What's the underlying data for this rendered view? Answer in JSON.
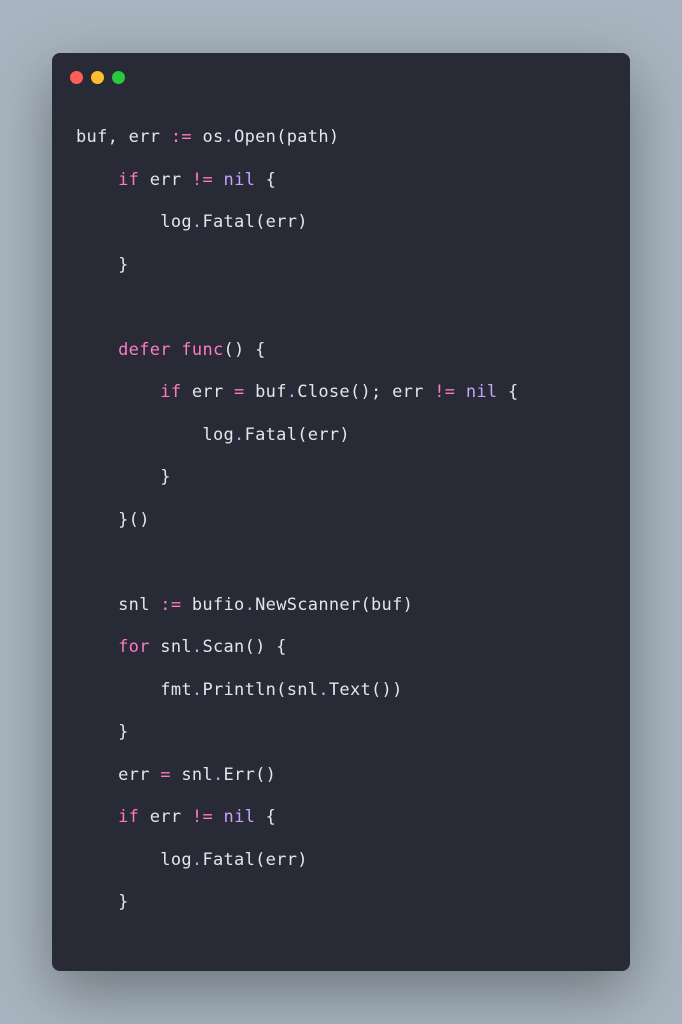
{
  "code": {
    "tokens": [
      [
        {
          "t": "buf, err ",
          "c": "id"
        },
        {
          "t": ":=",
          "c": "op"
        },
        {
          "t": " os",
          "c": "id"
        },
        {
          "t": ".",
          "c": "dot"
        },
        {
          "t": "Open(path)",
          "c": "fn"
        }
      ],
      [
        {
          "t": "    ",
          "c": "id"
        },
        {
          "t": "if",
          "c": "kw"
        },
        {
          "t": " err ",
          "c": "id"
        },
        {
          "t": "!=",
          "c": "op"
        },
        {
          "t": " ",
          "c": "id"
        },
        {
          "t": "nil",
          "c": "nil"
        },
        {
          "t": " {",
          "c": "brace"
        }
      ],
      [
        {
          "t": "        log",
          "c": "id"
        },
        {
          "t": ".",
          "c": "dot"
        },
        {
          "t": "Fatal(err)",
          "c": "fn"
        }
      ],
      [
        {
          "t": "    }",
          "c": "brace"
        }
      ],
      [
        {
          "t": "",
          "c": "id"
        }
      ],
      [
        {
          "t": "    ",
          "c": "id"
        },
        {
          "t": "defer",
          "c": "kw"
        },
        {
          "t": " ",
          "c": "id"
        },
        {
          "t": "func",
          "c": "kw"
        },
        {
          "t": "() {",
          "c": "brace"
        }
      ],
      [
        {
          "t": "        ",
          "c": "id"
        },
        {
          "t": "if",
          "c": "kw"
        },
        {
          "t": " err ",
          "c": "id"
        },
        {
          "t": "=",
          "c": "op"
        },
        {
          "t": " buf",
          "c": "id"
        },
        {
          "t": ".",
          "c": "dot"
        },
        {
          "t": "Close(); err ",
          "c": "fn"
        },
        {
          "t": "!=",
          "c": "op"
        },
        {
          "t": " ",
          "c": "id"
        },
        {
          "t": "nil",
          "c": "nil"
        },
        {
          "t": " {",
          "c": "brace"
        }
      ],
      [
        {
          "t": "            log",
          "c": "id"
        },
        {
          "t": ".",
          "c": "dot"
        },
        {
          "t": "Fatal(err)",
          "c": "fn"
        }
      ],
      [
        {
          "t": "        }",
          "c": "brace"
        }
      ],
      [
        {
          "t": "    }()",
          "c": "brace"
        }
      ],
      [
        {
          "t": "",
          "c": "id"
        }
      ],
      [
        {
          "t": "    snl ",
          "c": "id"
        },
        {
          "t": ":=",
          "c": "op"
        },
        {
          "t": " bufio",
          "c": "id"
        },
        {
          "t": ".",
          "c": "dot"
        },
        {
          "t": "NewScanner(buf)",
          "c": "fn"
        }
      ],
      [
        {
          "t": "    ",
          "c": "id"
        },
        {
          "t": "for",
          "c": "kw"
        },
        {
          "t": " snl",
          "c": "id"
        },
        {
          "t": ".",
          "c": "dot"
        },
        {
          "t": "Scan() {",
          "c": "fn"
        }
      ],
      [
        {
          "t": "        fmt",
          "c": "id"
        },
        {
          "t": ".",
          "c": "dot"
        },
        {
          "t": "Println(snl",
          "c": "fn"
        },
        {
          "t": ".",
          "c": "dot"
        },
        {
          "t": "Text())",
          "c": "fn"
        }
      ],
      [
        {
          "t": "    }",
          "c": "brace"
        }
      ],
      [
        {
          "t": "    err ",
          "c": "id"
        },
        {
          "t": "=",
          "c": "op"
        },
        {
          "t": " snl",
          "c": "id"
        },
        {
          "t": ".",
          "c": "dot"
        },
        {
          "t": "Err()",
          "c": "fn"
        }
      ],
      [
        {
          "t": "    ",
          "c": "id"
        },
        {
          "t": "if",
          "c": "kw"
        },
        {
          "t": " err ",
          "c": "id"
        },
        {
          "t": "!=",
          "c": "op"
        },
        {
          "t": " ",
          "c": "id"
        },
        {
          "t": "nil",
          "c": "nil"
        },
        {
          "t": " {",
          "c": "brace"
        }
      ],
      [
        {
          "t": "        log",
          "c": "id"
        },
        {
          "t": ".",
          "c": "dot"
        },
        {
          "t": "Fatal(err)",
          "c": "fn"
        }
      ],
      [
        {
          "t": "    }",
          "c": "brace"
        }
      ]
    ]
  }
}
